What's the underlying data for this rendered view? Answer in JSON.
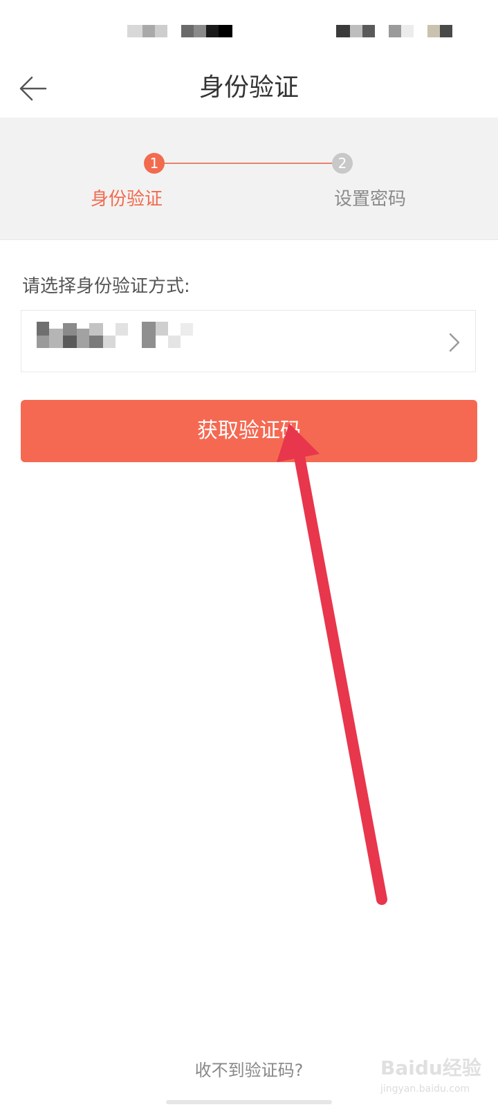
{
  "header": {
    "title": "身份验证"
  },
  "steps": [
    {
      "number": "1",
      "label": "身份验证",
      "color": "#f26b4f"
    },
    {
      "number": "2",
      "label": "设置密码",
      "color": "#c8c8c8"
    }
  ],
  "verify": {
    "prompt": "请选择身份验证方式:",
    "button_label": "获取验证码",
    "button_color": "#f56952"
  },
  "footer": {
    "no_code_link": "收不到验证码?"
  },
  "watermark": {
    "main": "Baidu经验",
    "sub": "jingyan.baidu.com"
  },
  "annotation": {
    "arrow_color": "#e8364c"
  }
}
